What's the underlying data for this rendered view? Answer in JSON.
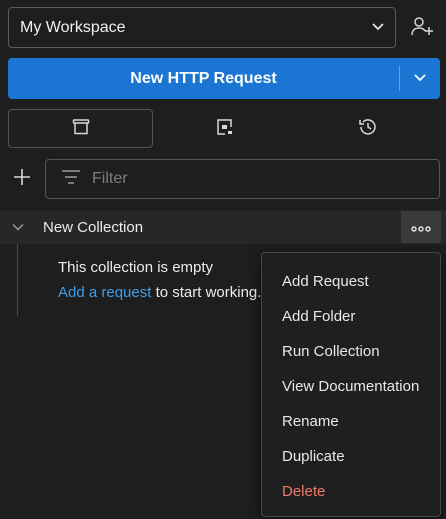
{
  "workspace": {
    "name": "My Workspace"
  },
  "new_request": {
    "label": "New HTTP Request"
  },
  "filter": {
    "placeholder": "Filter"
  },
  "collection": {
    "name": "New Collection",
    "empty_text": "This collection is empty",
    "add_link": "Add a request",
    "add_suffix": " to start working."
  },
  "context_menu": {
    "items": [
      "Add Request",
      "Add Folder",
      "Run Collection",
      "View Documentation",
      "Rename",
      "Duplicate",
      "Delete"
    ]
  },
  "colors": {
    "accent": "#1a76d2",
    "link": "#3f9eea",
    "danger": "#ee7a6a"
  }
}
